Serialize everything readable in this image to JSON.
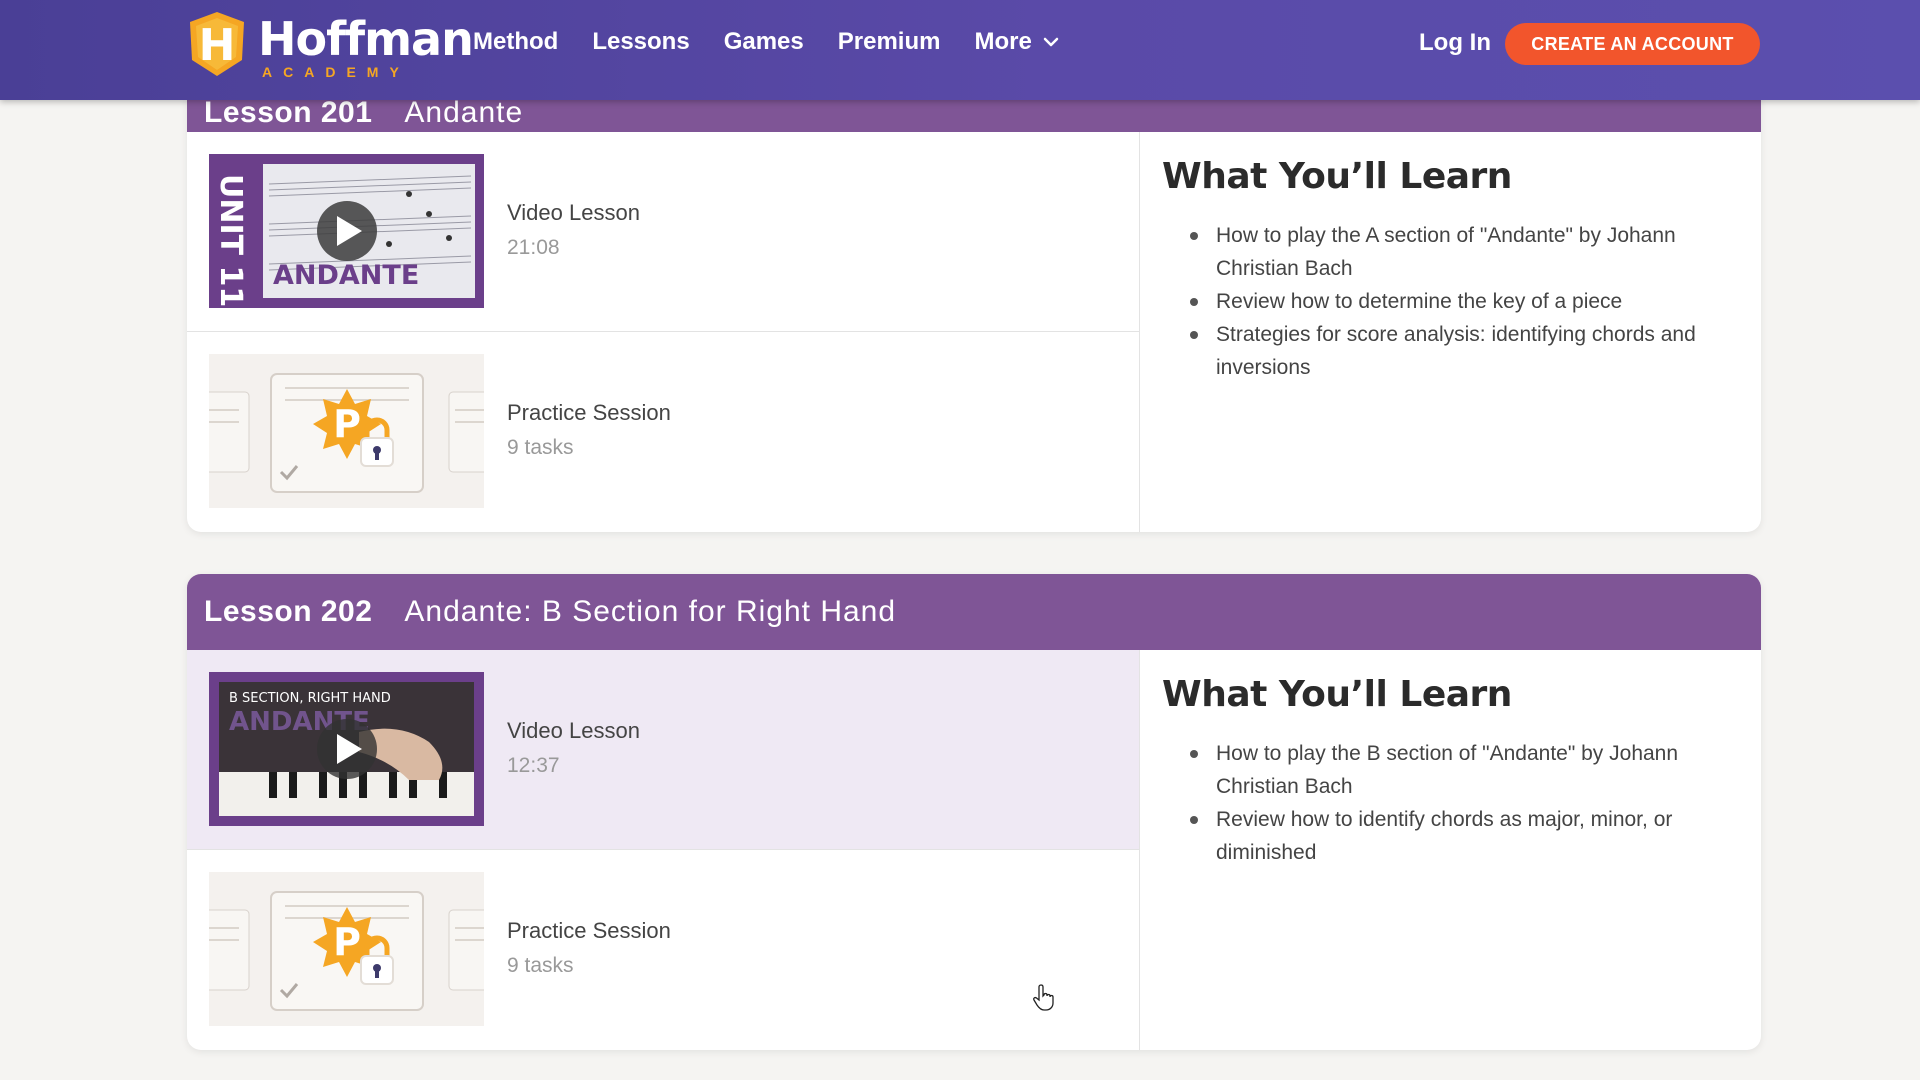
{
  "header": {
    "logo_word": "Hoffman",
    "logo_sub": "ACADEMY",
    "nav": [
      "Method",
      "Lessons",
      "Games",
      "Premium",
      "More"
    ],
    "login": "Log In",
    "cta": "CREATE AN ACCOUNT"
  },
  "lessons": [
    {
      "number": "Lesson 201",
      "name": "Andante",
      "video": {
        "title": "Video Lesson",
        "duration": "21:08",
        "thumb_unit": "UNIT 11",
        "thumb_title": "ANDANTE"
      },
      "practice": {
        "title": "Practice Session",
        "tasks": "9 tasks",
        "badge_letter": "P"
      },
      "learn_title": "What You’ll Learn",
      "learn": [
        "How to play the A section of \"Andante\" by Johann Christian Bach",
        "Review how to determine the key of a piece",
        "Strategies for score analysis: identifying chords and inversions"
      ]
    },
    {
      "number": "Lesson 202",
      "name": "Andante: B Section for Right Hand",
      "video": {
        "title": "Video Lesson",
        "duration": "12:37",
        "thumb_caption": "B SECTION, RIGHT HAND",
        "thumb_title": "ANDANTE"
      },
      "practice": {
        "title": "Practice Session",
        "tasks": "9 tasks",
        "badge_letter": "P"
      },
      "learn_title": "What You’ll Learn",
      "learn": [
        "How to play the B section of \"Andante\" by Johann Christian Bach",
        "Review how to identify chords as major, minor, or diminished"
      ]
    }
  ],
  "colors": {
    "header": "#5a4aa8",
    "lesson_header": "#7f5596",
    "cta": "#f2552c",
    "accent": "#f5a623"
  },
  "icons": [
    "play-icon",
    "lock-icon",
    "chevron-down-icon",
    "hand-pointer-icon"
  ]
}
